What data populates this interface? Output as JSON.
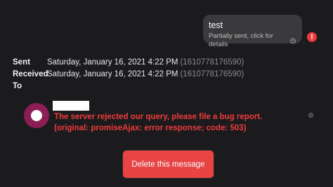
{
  "message": {
    "text": "test",
    "status": "Partially sent, click for details",
    "status_icon": "clock-icon",
    "error_icon": "exclamation-icon",
    "error_icon_glyph": "!"
  },
  "details": {
    "sent_label": "Sent",
    "sent_value": "Saturday, January 16, 2021 4:22 PM",
    "sent_timestamp": "(1610778176590)",
    "received_label": "Received",
    "received_value": "Saturday, January 16, 2021 4:22 PM",
    "received_timestamp": "(1610778176590)",
    "to_label": "To"
  },
  "recipient": {
    "avatar_color": "#8c1d55",
    "error": "The server rejected our query, please file a bug report. (original: promiseAjax: error response; code: 503)"
  },
  "actions": {
    "delete_label": "Delete this message"
  },
  "colors": {
    "background": "#1b1b1d",
    "bubble": "#3a3a3d",
    "error": "#ef3b3b",
    "button": "#e94343"
  }
}
